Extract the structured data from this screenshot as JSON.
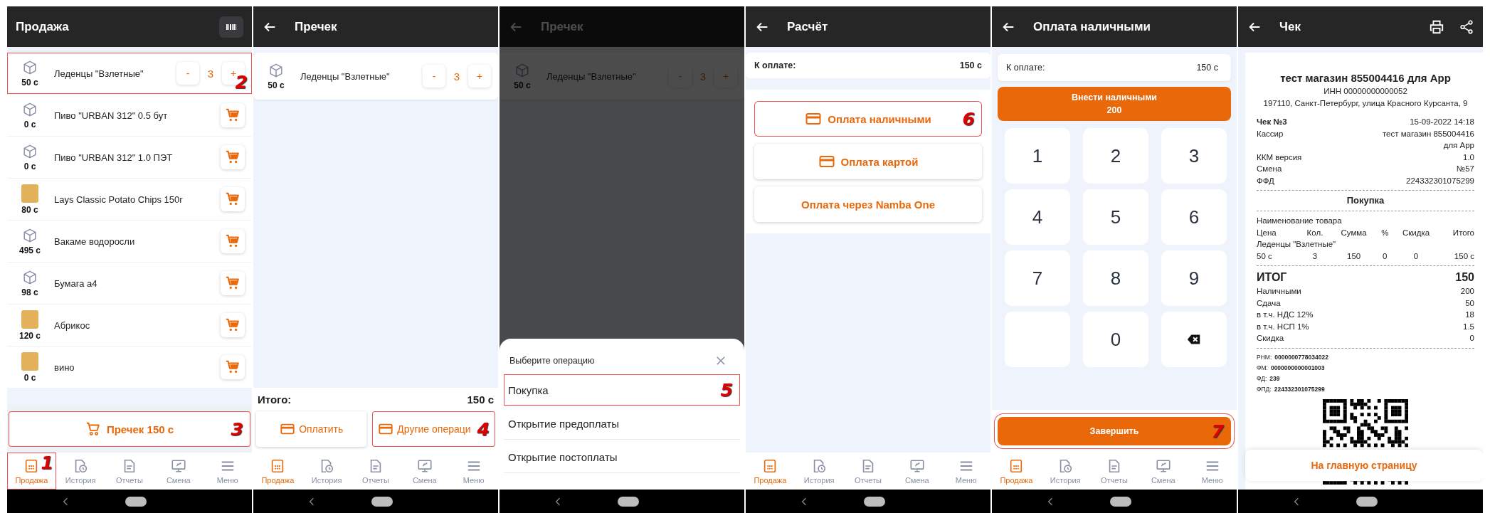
{
  "screens": [
    {
      "kind": "catalog",
      "title": "Продажа",
      "products": [
        {
          "name": "Леденцы \"Взлетные\"",
          "price": "50 с",
          "photo": false,
          "decrease": "-",
          "quantity": "3",
          "increase": "+",
          "step": "2"
        },
        {
          "name": "Пиво \"URBAN 312\" 0.5 бут",
          "price": "0 с",
          "photo": false
        },
        {
          "name": "Пиво \"URBAN 312\" 1.0 ПЭТ",
          "price": "0 с",
          "photo": false
        },
        {
          "name": "Lays Classic Potato Chips 150г",
          "price": "80 с",
          "photo": true
        },
        {
          "name": "Вакаме водоросли",
          "price": "495 с",
          "photo": false
        },
        {
          "name": "Бумага а4",
          "price": "98 с",
          "photo": false
        },
        {
          "name": "Абрикос",
          "price": "120 с",
          "photo": true
        },
        {
          "name": "вино",
          "price": "0 с",
          "photo": true
        }
      ],
      "checkout_button": {
        "label": "Пречек 150 с",
        "step": "3"
      },
      "nav": [
        {
          "label": "Продажа",
          "selected": true,
          "step": "1"
        },
        {
          "label": "История",
          "selected": false
        },
        {
          "label": "Отчеты",
          "selected": false
        },
        {
          "label": "Смена",
          "selected": false
        },
        {
          "label": "Меню",
          "selected": false
        }
      ]
    },
    {
      "kind": "precheck",
      "title": "Пречек",
      "products": [
        {
          "name": "Леденцы \"Взлетные\"",
          "price": "50 с",
          "photo": false,
          "decrease": "-",
          "quantity": "3",
          "increase": "+"
        }
      ],
      "total": {
        "label": "Итого:",
        "value": "150 с"
      },
      "actions": [
        {
          "label": "Оплатить"
        },
        {
          "label": "Другие операци",
          "step": "4"
        }
      ],
      "nav": [
        {
          "label": "Продажа",
          "selected": true
        },
        {
          "label": "История",
          "selected": false
        },
        {
          "label": "Отчеты",
          "selected": false
        },
        {
          "label": "Смена",
          "selected": false
        },
        {
          "label": "Меню",
          "selected": false
        }
      ]
    },
    {
      "kind": "operation-sheet",
      "title": "Пречек",
      "products": [
        {
          "name": "Леденцы \"Взлетные\"",
          "price": "50 с",
          "photo": false,
          "decrease": "-",
          "quantity": "3",
          "increase": "+"
        }
      ],
      "sheet": {
        "title": "Выберите операцию",
        "options": [
          {
            "label": "Покупка",
            "step": "5"
          },
          {
            "label": "Открытие предоплаты"
          },
          {
            "label": "Открытие постоплаты"
          }
        ]
      }
    },
    {
      "kind": "payment",
      "title": "Расчёт",
      "due": {
        "label": "К оплате:",
        "value": "150 с"
      },
      "methods": [
        {
          "label": "Оплата наличными",
          "card_icon": true,
          "step": "6"
        },
        {
          "label": "Оплата картой",
          "card_icon": true
        },
        {
          "label": "Оплата через Namba One",
          "card_icon": false
        }
      ],
      "nav": [
        {
          "label": "Продажа",
          "selected": true
        },
        {
          "label": "История",
          "selected": false
        },
        {
          "label": "Отчеты",
          "selected": false
        },
        {
          "label": "Смена",
          "selected": false
        },
        {
          "label": "Меню",
          "selected": false
        }
      ]
    },
    {
      "kind": "cash",
      "title": "Оплата наличными",
      "due": {
        "label": "К оплате:",
        "value": "150 с"
      },
      "deposit": {
        "label": "Внести наличными",
        "amount": "200"
      },
      "keys": [
        {
          "kind": "digit",
          "label": "1"
        },
        {
          "kind": "digit",
          "label": "2"
        },
        {
          "kind": "digit",
          "label": "3"
        },
        {
          "kind": "digit",
          "label": "4"
        },
        {
          "kind": "digit",
          "label": "5"
        },
        {
          "kind": "digit",
          "label": "6"
        },
        {
          "kind": "digit",
          "label": "7"
        },
        {
          "kind": "digit",
          "label": "8"
        },
        {
          "kind": "digit",
          "label": "9"
        },
        {
          "kind": "blank"
        },
        {
          "kind": "digit",
          "label": "0"
        },
        {
          "kind": "backspace"
        }
      ],
      "finish_button": {
        "label": "Завершить",
        "step": "7"
      },
      "nav": [
        {
          "label": "Продажа",
          "selected": true
        },
        {
          "label": "История",
          "selected": false
        },
        {
          "label": "Отчеты",
          "selected": false
        },
        {
          "label": "Смена",
          "selected": false
        },
        {
          "label": "Меню",
          "selected": false
        }
      ]
    },
    {
      "kind": "receipt",
      "title": "Чек",
      "receipt": {
        "store": "тест магазин 855004416 для App",
        "inn": "ИНН 00000000000052",
        "address": "197110, Санкт-Петербург, улица Красного Курсанта, 9",
        "info": [
          {
            "label": "Чек №3",
            "value": "15-09-2022 14:18",
            "bold": true
          },
          {
            "label": "Кассир",
            "value": "тест магазин 855004416 для App",
            "bold": false
          },
          {
            "label": "ККМ версия",
            "value": "1.0",
            "bold": false
          },
          {
            "label": "Смена",
            "value": "№57",
            "bold": false
          },
          {
            "label": "ФФД",
            "value": "224332301075299",
            "bold": false
          }
        ],
        "operation": "Покупка",
        "item_header": "Наименование товара",
        "columns": [
          "Цена",
          "Кол.",
          "Сумма",
          "%",
          "Скидка",
          "Итого"
        ],
        "items": [
          {
            "name": "Леденцы \"Взлетные\"",
            "cells": [
              "50 с",
              "3",
              "150",
              "0",
              "0",
              "150 с"
            ]
          }
        ],
        "total": {
          "label": "ИТОГ",
          "value": "150"
        },
        "payments": [
          {
            "label": "Наличными",
            "value": "200"
          },
          {
            "label": "Сдача",
            "value": "50"
          },
          {
            "label": "в т.ч. НДС 12%",
            "value": "18"
          },
          {
            "label": "в т.ч. НСП 1%",
            "value": "1.5"
          },
          {
            "label": "Скидка",
            "value": "0"
          }
        ],
        "fiscal": [
          {
            "label": "РНМ:",
            "value": "0000000778034022"
          },
          {
            "label": "ФМ:",
            "value": "0000000000001003"
          },
          {
            "label": "ФД:",
            "value": "239"
          },
          {
            "label": "ФПД:",
            "value": "224332301075299"
          }
        ]
      },
      "home_button": "На главную страницу"
    }
  ]
}
